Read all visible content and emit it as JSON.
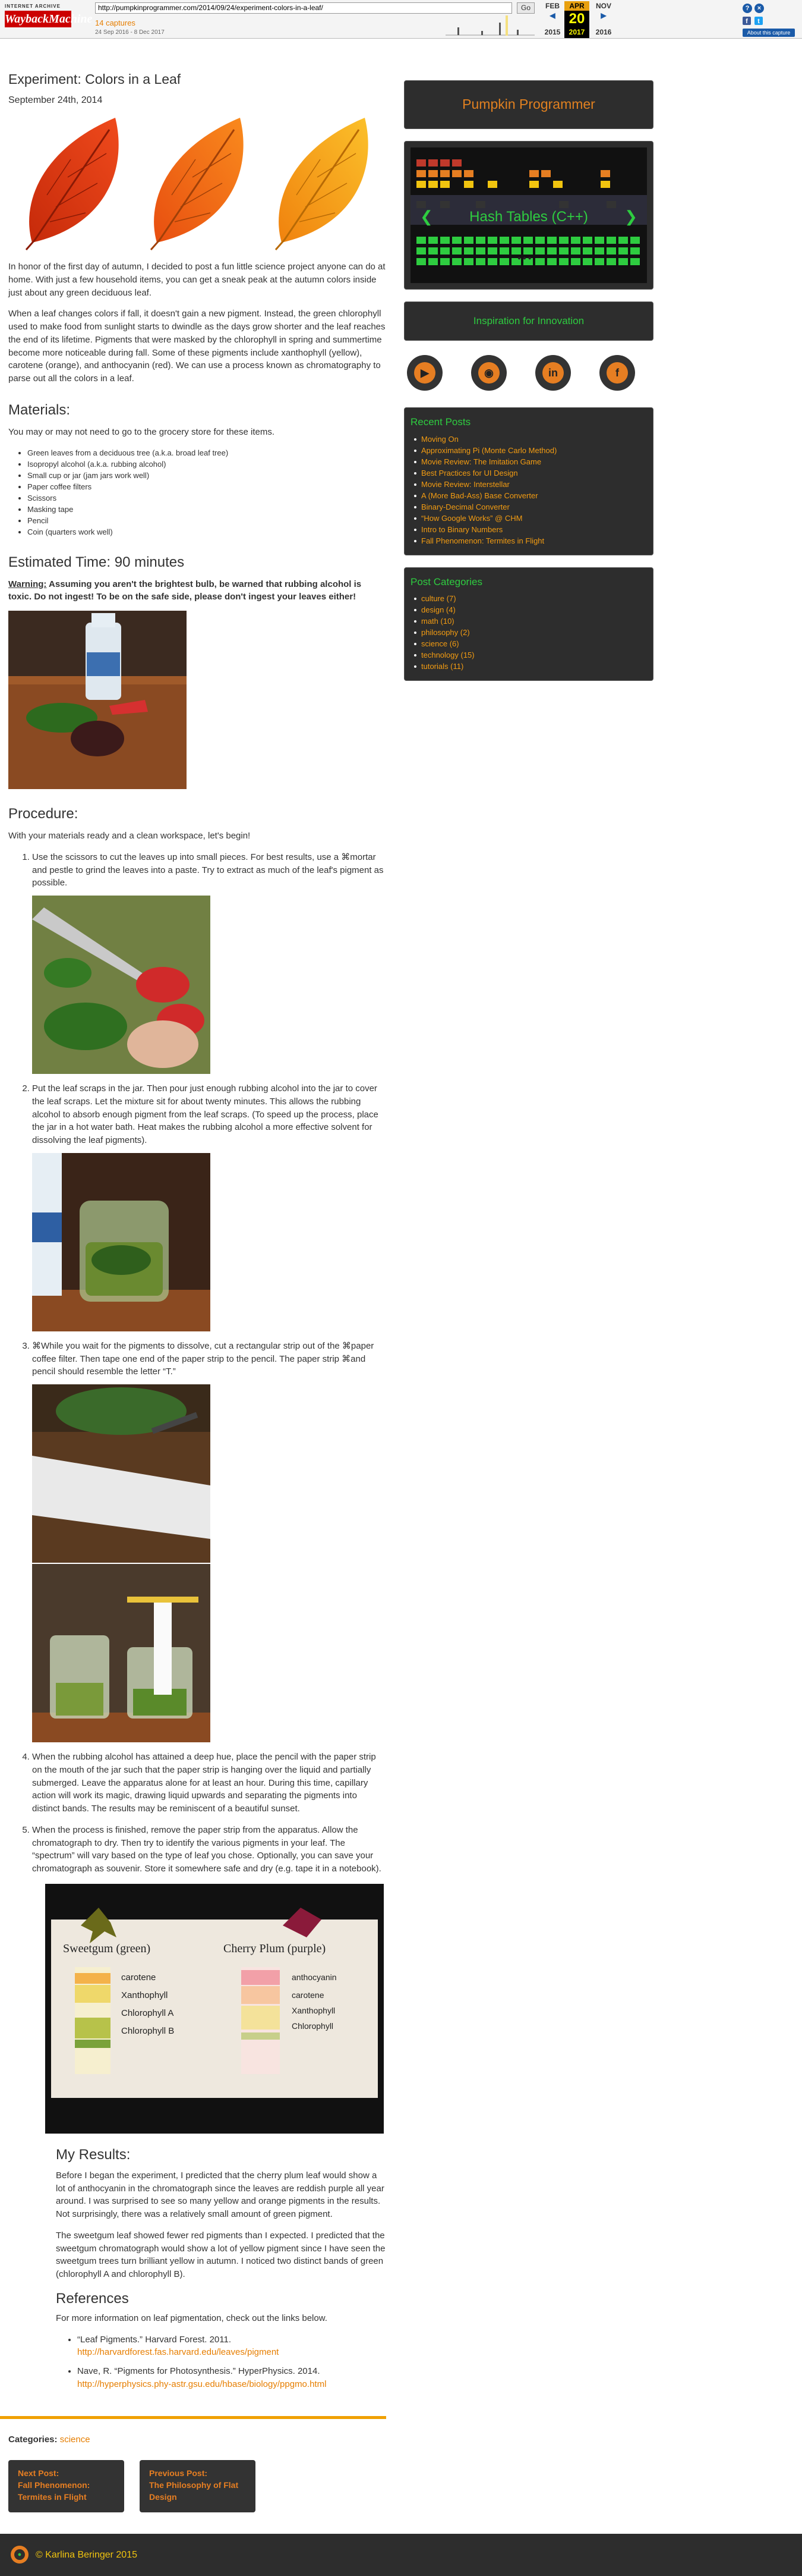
{
  "wayback": {
    "label_top": "INTERNET ARCHIVE",
    "logo": "WaybackMachine",
    "url": "http://pumpkinprogrammer.com/2014/09/24/experiment-colors-in-a-leaf/",
    "go": "Go",
    "captures": "14 captures",
    "range": "24 Sep 2016 - 8 Dec 2017",
    "months": [
      "FEB",
      "APR",
      "NOV"
    ],
    "day": "20",
    "years": [
      "2015",
      "2017",
      "2016"
    ],
    "about": "About this capture"
  },
  "post": {
    "title": "Experiment: Colors in a Leaf",
    "date": "September 24th, 2014",
    "intro1": "In honor of the first day of autumn, I decided to post a fun little science project anyone can do at home. With just a few household items, you can get a sneak peak at the autumn colors inside just about any green deciduous leaf.",
    "intro2": "When a leaf changes colors if fall, it doesn't gain a new pigment. Instead, the green chlorophyll used to make food from sunlight starts to dwindle as the days grow shorter and the leaf reaches the end of its lifetime. Pigments that were masked by the chlorophyll in spring and summertime become more noticeable during fall. Some of these pigments include xanthophyll (yellow), carotene (orange), and anthocyanin (red). We can use a process known as chromatography to parse out all the colors in a leaf.",
    "materials_heading": "Materials:",
    "materials_intro": "You may or may not need to go to the grocery store for these items.",
    "materials": [
      "Green leaves from a deciduous tree (a.k.a. broad leaf tree)",
      "Isopropyl alcohol (a.k.a. rubbing alcohol)",
      "Small cup or jar (jam jars work well)",
      "Paper coffee filters",
      "Scissors",
      "Masking tape",
      "Pencil",
      "Coin (quarters work well)"
    ],
    "time_heading": "Estimated Time: 90 minutes",
    "warning_label": "Warning:",
    "warning_text": " Assuming you aren't the brightest bulb, be warned that rubbing alcohol is toxic. Do not ingest! To be on the safe side, please don't ingest your leaves either!",
    "procedure_heading": "Procedure:",
    "procedure_intro": "With your materials ready and a clean workspace, let's begin!",
    "steps": [
      "Use the scissors to cut the leaves up into small pieces. For best results, use a ⌘mortar and pestle to grind the leaves into a paste. Try to extract as much of the leaf's pigment as possible.",
      "Put the leaf scraps in the jar. Then pour just enough rubbing alcohol into the jar to cover the leaf scraps. Let the mixture sit for about twenty minutes. This allows the rubbing alcohol to absorb enough pigment from the leaf scraps. (To speed up the process, place the jar in a hot water bath. Heat makes the rubbing alcohol a more effective solvent for dissolving the leaf pigments).",
      "⌘While you wait for the pigments to dissolve, cut a rectangular strip out of the ⌘paper coffee filter. Then tape one end of the paper strip to the pencil. The paper strip ⌘and pencil should resemble the letter “T.”",
      "When the rubbing alcohol has attained a deep hue, place the pencil with the paper strip on the mouth of the jar such that the paper strip is hanging over the liquid and partially submerged. Leave the apparatus alone for at least an hour. During this time, capillary action will work its magic, drawing liquid upwards and separating the pigments into distinct bands. The results may be reminiscent of a beautiful sunset.",
      "When the process is finished, remove the paper strip from the apparatus. Allow the chromatograph to dry. Then try to identify the various pigments in your leaf. The “spectrum” will vary based on the type of leaf you chose. Optionally, you can save your chromatograph as souvenir. Store it somewhere safe and dry (e.g. tape it in a notebook)."
    ],
    "chromatograph": {
      "left_title": "Sweetgum (green)",
      "right_title": "Cherry Plum (purple)",
      "left_labels": [
        "carotene",
        "Xanthophyll",
        "Chlorophyll A",
        "Chlorophyll B"
      ],
      "right_labels": [
        "anthocyanin",
        "carotene",
        "Xanthophyll",
        "Chlorophyll"
      ]
    },
    "results_heading": "My Results:",
    "results1": "Before I began the experiment, I predicted that the cherry plum leaf would show a lot of anthocyanin in the chromatograph since the leaves are reddish purple all year around. I was surprised to see so many yellow and orange pigments in the results. Not surprisingly, there was a relatively small amount of green pigment.",
    "results2": "The sweetgum leaf showed fewer red pigments than I expected. I predicted that the sweetgum chromatograph would show a lot of yellow pigment since I have seen the sweetgum trees turn brilliant yellow in autumn. I noticed two distinct bands of green (chlorophyll A and chlorophyll B).",
    "refs_heading": "References",
    "refs_intro": "For more information on leaf pigmentation, check out the links below.",
    "refs": [
      {
        "text": "“Leaf Pigments.” Harvard Forest. 2011.",
        "link": "http://harvardforest.fas.harvard.edu/leaves/pigment"
      },
      {
        "text": "Nave, R. “Pigments for Photosynthesis.” HyperPhysics. 2014.",
        "link": "http://hyperphysics.phy-astr.gsu.edu/hbase/biology/ppgmo.html"
      }
    ],
    "categories_label": "Categories:",
    "category": "science",
    "next_label": "Next Post:",
    "next_title": "Fall Phenomenon: Termites in Flight",
    "prev_label": "Previous Post:",
    "prev_title": "The Philosophy of Flat Design"
  },
  "sidebar": {
    "site_title": "Pumpkin Programmer",
    "slider_title": "Hash Tables (C++)",
    "inspiration": "Inspiration for Innovation",
    "social": [
      "youtube-icon",
      "github-icon",
      "linkedin-icon",
      "facebook-icon"
    ],
    "recent_heading": "Recent Posts",
    "recent": [
      "Moving On",
      "Approximating Pi (Monte Carlo Method)",
      "Movie Review: The Imitation Game",
      "Best Practices for UI Design",
      "Movie Review: Interstellar",
      "A (More Bad-Ass) Base Converter",
      "Binary-Decimal Converter",
      "“How Google Works” @ CHM",
      "Intro to Binary Numbers",
      "Fall Phenomenon: Termites in Flight"
    ],
    "categories_heading": "Post Categories",
    "categories": [
      "culture (7)",
      "design (4)",
      "math (10)",
      "philosophy (2)",
      "science (6)",
      "technology (15)",
      "tutorials (11)"
    ]
  },
  "footer": {
    "copyright": "© Karlina Beringer 2015"
  },
  "colors": {
    "accent": "#e67e22",
    "dark": "#2d2d2d",
    "link": "#f39c12",
    "green_title": "#2ecc40"
  }
}
